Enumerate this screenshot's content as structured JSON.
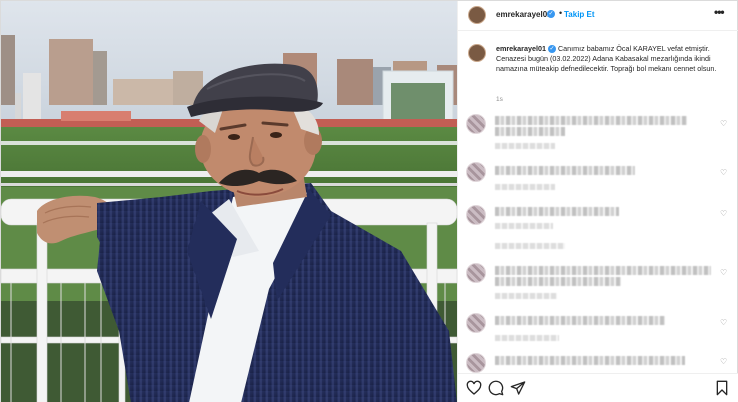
{
  "profile": {
    "username": "emrekarayel01",
    "follow_label": "Takip Et",
    "separator": "•",
    "more_label": "•••"
  },
  "caption": {
    "username": "emrekarayel01",
    "text": "Canımız babamız Öcal KARAYEL vefat etmiştir. Cenazesi bugün (03.02.2022) Adana Kabasakal mezarlığında ikindi namazına müteakip defnedilecektir. Toprağı bol mekanı cennet olsun.",
    "time": "1s"
  },
  "comments": [
    {
      "blurred": true
    },
    {
      "blurred": true
    },
    {
      "blurred": true
    },
    {
      "blurred": true
    },
    {
      "blurred": true
    },
    {
      "blurred": true
    }
  ],
  "icons": {
    "verified": "verified-badge-icon",
    "like": "heart-icon",
    "comment": "comment-icon",
    "share": "paper-plane-icon",
    "save": "bookmark-icon"
  },
  "colors": {
    "follow_blue": "#0095f6",
    "verified_blue": "#3897f0",
    "muted": "#8e8e8e"
  },
  "glyphs": {
    "verified_check": "✓",
    "small_heart": "♡"
  }
}
